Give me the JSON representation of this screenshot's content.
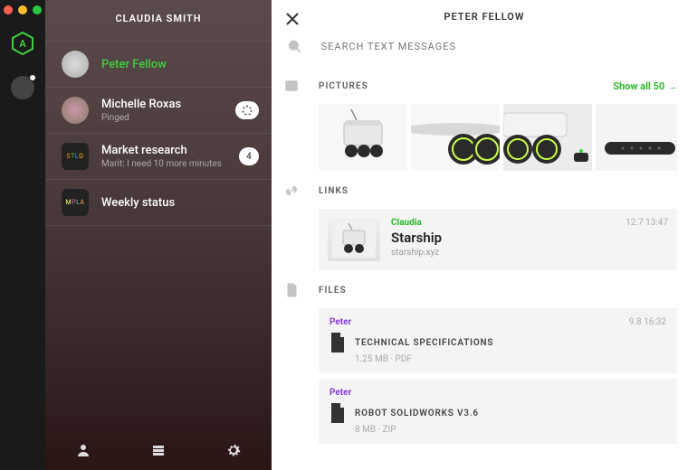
{
  "sidebar": {
    "owner": "CLAUDIA SMITH",
    "items": [
      {
        "name": "Peter Fellow",
        "sub": "",
        "active": true,
        "badge": null
      },
      {
        "name": "Michelle Roxas",
        "sub": "Pinged",
        "badge": "loading"
      },
      {
        "name": "Market research",
        "sub": "Marit: I need 10 more minutes",
        "badge": "4"
      },
      {
        "name": "Weekly status",
        "sub": "",
        "badge": null
      }
    ]
  },
  "main": {
    "title": "PETER FELLOW",
    "search_placeholder": "SEARCH TEXT MESSAGES",
    "pictures": {
      "label": "PICTURES",
      "show_all": "Show all 50 →"
    },
    "links": {
      "label": "LINKS",
      "items": [
        {
          "who": "Claudia",
          "title": "Starship",
          "meta": "starship.xyz",
          "ts": "12.7 13:47"
        }
      ]
    },
    "files": {
      "label": "FILES",
      "items": [
        {
          "who": "Peter",
          "name": "TECHNICAL SPECIFICATIONS",
          "meta": "1.25 MB · PDF",
          "ts": "9.8 16:32"
        },
        {
          "who": "Peter",
          "name": "ROBOT SOLIDWORKS V3.6",
          "meta": "8 MB · ZIP",
          "ts": ""
        }
      ]
    }
  }
}
